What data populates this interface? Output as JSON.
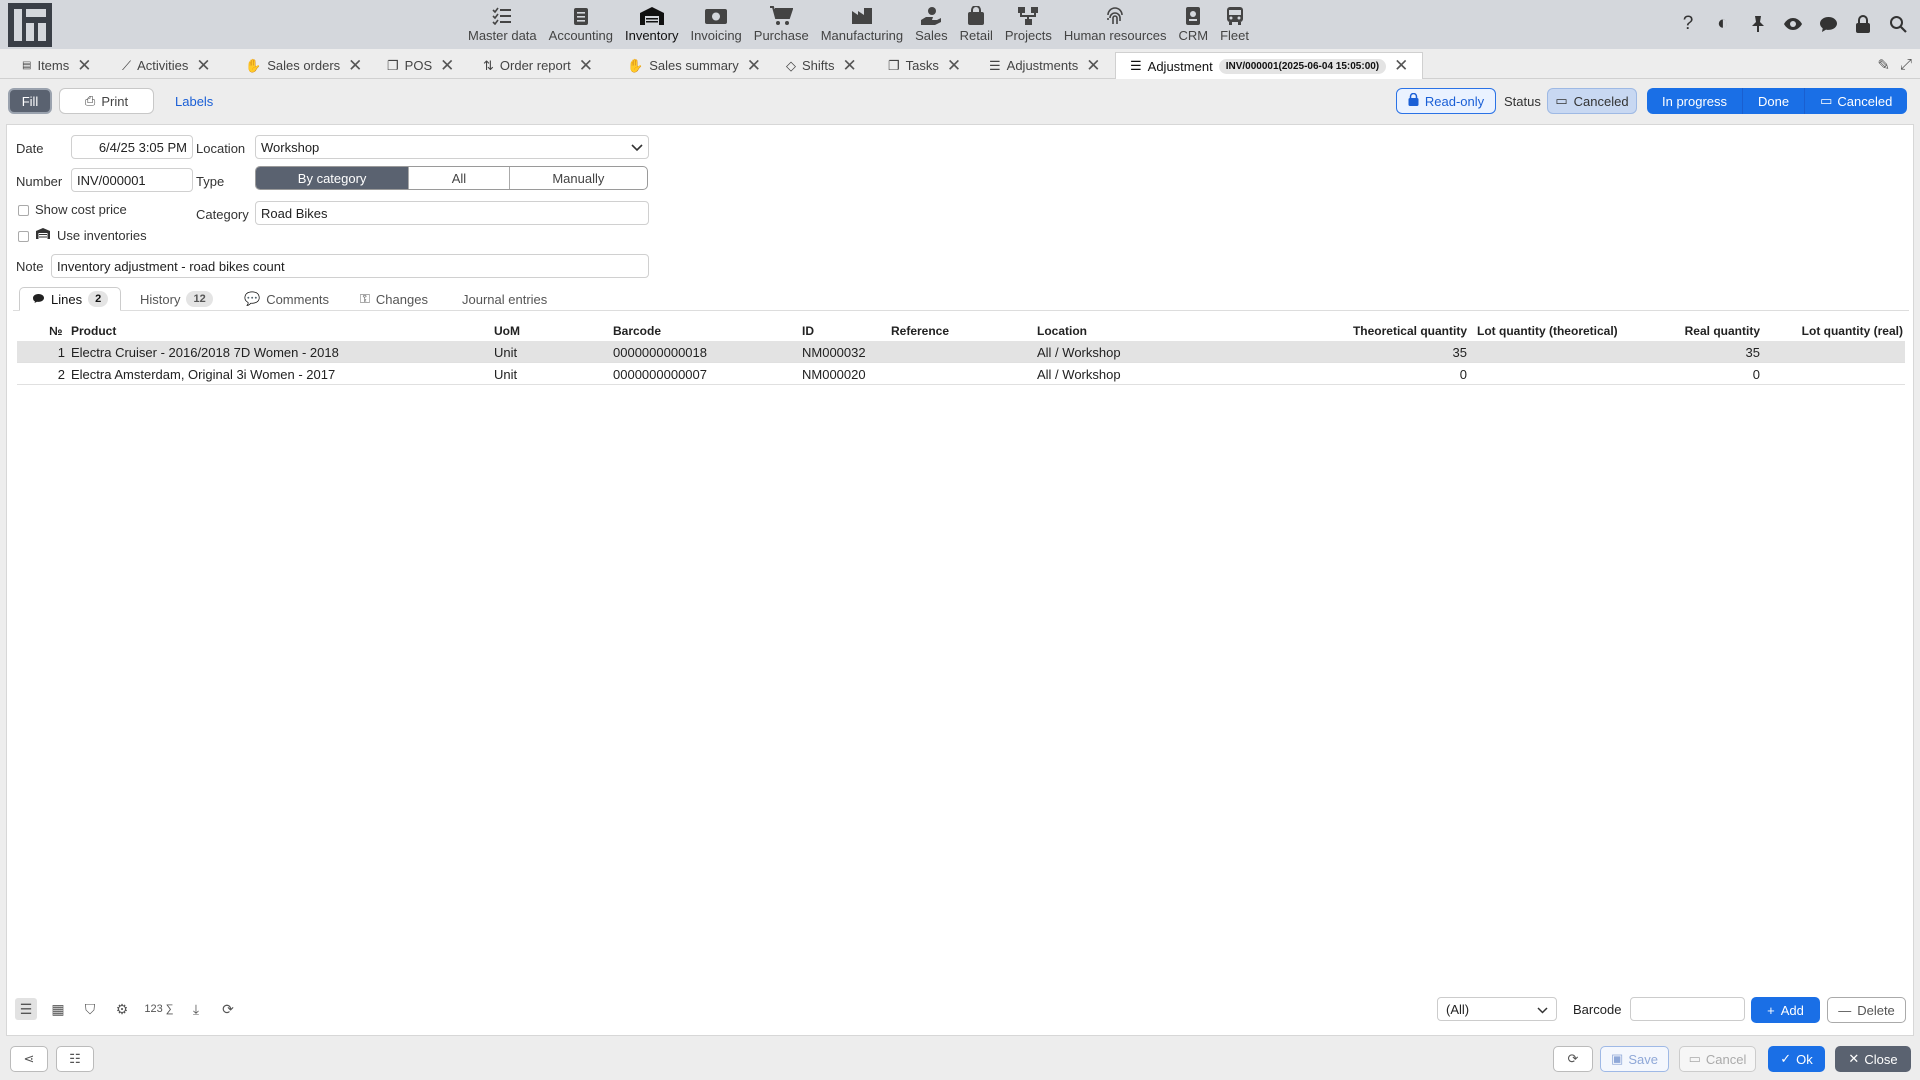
{
  "colors": {
    "accent": "#1a6fe6",
    "topbar": "#d4d7dc",
    "active_segment": "#5a6270"
  },
  "modules": [
    {
      "label": "Master data",
      "icon": "checklist-icon"
    },
    {
      "label": "Accounting",
      "icon": "ledger-icon"
    },
    {
      "label": "Inventory",
      "icon": "warehouse-icon"
    },
    {
      "label": "Invoicing",
      "icon": "money-icon"
    },
    {
      "label": "Purchase",
      "icon": "cart-icon"
    },
    {
      "label": "Manufacturing",
      "icon": "factory-icon"
    },
    {
      "label": "Sales",
      "icon": "hand-money-icon"
    },
    {
      "label": "Retail",
      "icon": "shopping-bag-icon"
    },
    {
      "label": "Projects",
      "icon": "hierarchy-icon"
    },
    {
      "label": "Human resources",
      "icon": "fingerprint-icon"
    },
    {
      "label": "CRM",
      "icon": "contact-card-icon"
    },
    {
      "label": "Fleet",
      "icon": "bus-icon"
    }
  ],
  "tabs": [
    {
      "label": "Items"
    },
    {
      "label": "Activities"
    },
    {
      "label": "Sales orders"
    },
    {
      "label": "POS"
    },
    {
      "label": "Order report"
    },
    {
      "label": "Sales summary"
    },
    {
      "label": "Shifts"
    },
    {
      "label": "Tasks"
    },
    {
      "label": "Adjustments"
    },
    {
      "label": "Adjustment",
      "badge": "INV/000001(2025-06-04 15:05:00)"
    }
  ],
  "toolbar": {
    "fill": "Fill",
    "print": "Print",
    "labels": "Labels",
    "readonly": "Read-only",
    "status_label": "Status",
    "status_current": "Canceled",
    "status_options": [
      "In progress",
      "Done",
      "Canceled"
    ]
  },
  "form": {
    "date_label": "Date",
    "date_value": "6/4/25 3:05 PM",
    "location_label": "Location",
    "location_value": "Workshop",
    "number_label": "Number",
    "number_value": "INV/000001",
    "type_label": "Type",
    "type_options": [
      "By category",
      "All",
      "Manually"
    ],
    "show_cost_label": "Show cost price",
    "use_inventories_label": "Use inventories",
    "category_label": "Category",
    "category_value": "Road Bikes",
    "note_label": "Note",
    "note_value": "Inventory adjustment - road bikes count"
  },
  "subtabs": {
    "lines": "Lines",
    "lines_count": "2",
    "history": "History",
    "history_count": "12",
    "comments": "Comments",
    "changes": "Changes",
    "journal": "Journal entries"
  },
  "table": {
    "columns": {
      "no": "№",
      "product": "Product",
      "uom": "UoM",
      "barcode": "Barcode",
      "id": "ID",
      "reference": "Reference",
      "location": "Location",
      "theoretical": "Theoretical quantity",
      "lot_theoretical": "Lot quantity (theoretical)",
      "real": "Real quantity",
      "lot_real": "Lot quantity (real)"
    },
    "rows": [
      {
        "no": "1",
        "product": "Electra Cruiser - 2016/2018 7D Women - 2018",
        "uom": "Unit",
        "barcode": "0000000000018",
        "id": "NM000032",
        "reference": "",
        "location": "All / Workshop",
        "theoretical": "35",
        "lot_theoretical": "",
        "real": "35",
        "lot_real": ""
      },
      {
        "no": "2",
        "product": "Electra Amsterdam, Original 3i Women - 2017",
        "uom": "Unit",
        "barcode": "0000000000007",
        "id": "NM000020",
        "reference": "",
        "location": "All / Workshop",
        "theoretical": "0",
        "lot_theoretical": "",
        "real": "0",
        "lot_real": ""
      }
    ]
  },
  "bottom": {
    "count_icon_label": "123 ∑",
    "filter_select": "(All)",
    "barcode_label": "Barcode",
    "add": "Add",
    "delete": "Delete"
  },
  "footer": {
    "save": "Save",
    "cancel": "Cancel",
    "ok": "Ok",
    "close": "Close"
  }
}
